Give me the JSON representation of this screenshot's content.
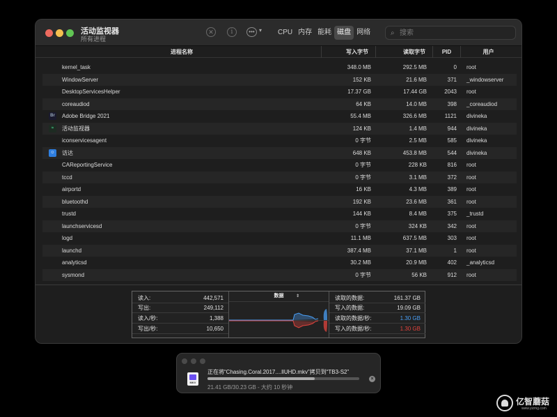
{
  "window": {
    "title": "活动监视器",
    "subtitle": "所有进程"
  },
  "toolbar": {
    "tabs": [
      "CPU",
      "内存",
      "能耗",
      "磁盘",
      "网络"
    ],
    "active_tab": "磁盘",
    "search_placeholder": "搜索"
  },
  "columns": {
    "name": "进程名称",
    "bytes_written": "写入字节",
    "bytes_read": "读取字节",
    "pid": "PID",
    "user": "用户"
  },
  "processes": [
    {
      "name": "kernel_task",
      "written": "348.0 MB",
      "read": "292.5 MB",
      "pid": "0",
      "user": "root",
      "icon": ""
    },
    {
      "name": "WindowServer",
      "written": "152 KB",
      "read": "21.6 MB",
      "pid": "371",
      "user": "_windowserver",
      "icon": ""
    },
    {
      "name": "DesktopServicesHelper",
      "written": "17.37 GB",
      "read": "17.44 GB",
      "pid": "2043",
      "user": "root",
      "icon": ""
    },
    {
      "name": "coreaudiod",
      "written": "64 KB",
      "read": "14.0 MB",
      "pid": "398",
      "user": "_coreaudiod",
      "icon": ""
    },
    {
      "name": "Adobe Bridge 2021",
      "written": "55.4 MB",
      "read": "326.6 MB",
      "pid": "1121",
      "user": "divineka",
      "icon": "bridge-icon"
    },
    {
      "name": "活动监视器",
      "written": "124 KB",
      "read": "1.4 MB",
      "pid": "944",
      "user": "divineka",
      "icon": "activity-monitor-icon"
    },
    {
      "name": "iconservicesagent",
      "written": "0 字节",
      "read": "2.5 MB",
      "pid": "585",
      "user": "divineka",
      "icon": ""
    },
    {
      "name": "访达",
      "written": "648 KB",
      "read": "453.8 MB",
      "pid": "544",
      "user": "divineka",
      "icon": "finder-icon"
    },
    {
      "name": "CAReportingService",
      "written": "0 字节",
      "read": "228 KB",
      "pid": "816",
      "user": "root",
      "icon": ""
    },
    {
      "name": "tccd",
      "written": "0 字节",
      "read": "3.1 MB",
      "pid": "372",
      "user": "root",
      "icon": ""
    },
    {
      "name": "airportd",
      "written": "16 KB",
      "read": "4.3 MB",
      "pid": "389",
      "user": "root",
      "icon": ""
    },
    {
      "name": "bluetoothd",
      "written": "192 KB",
      "read": "23.6 MB",
      "pid": "361",
      "user": "root",
      "icon": ""
    },
    {
      "name": "trustd",
      "written": "144 KB",
      "read": "8.4 MB",
      "pid": "375",
      "user": "_trustd",
      "icon": ""
    },
    {
      "name": "launchservicesd",
      "written": "0 字节",
      "read": "324 KB",
      "pid": "342",
      "user": "root",
      "icon": ""
    },
    {
      "name": "logd",
      "written": "11.1 MB",
      "read": "637.5 MB",
      "pid": "303",
      "user": "root",
      "icon": ""
    },
    {
      "name": "launchd",
      "written": "387.4 MB",
      "read": "37.1 MB",
      "pid": "1",
      "user": "root",
      "icon": ""
    },
    {
      "name": "analyticsd",
      "written": "30.2 MB",
      "read": "20.9 MB",
      "pid": "402",
      "user": "_analyticsd",
      "icon": ""
    },
    {
      "name": "sysmond",
      "written": "0 字节",
      "read": "56 KB",
      "pid": "912",
      "user": "root",
      "icon": ""
    }
  ],
  "stats_left": [
    {
      "label": "读入:",
      "value": "442,571"
    },
    {
      "label": "写出:",
      "value": "249,112"
    },
    {
      "label": "读入/秒:",
      "value": "1,388"
    },
    {
      "label": "写出/秒:",
      "value": "10,650"
    }
  ],
  "graph": {
    "title": "数据",
    "read_color": "#4a9ff5",
    "write_color": "#e0443e"
  },
  "stats_right": [
    {
      "label": "读取的数据:",
      "value": "161.37 GB",
      "color": ""
    },
    {
      "label": "写入的数据:",
      "value": "19.09 GB",
      "color": ""
    },
    {
      "label": "读取的数据/秒:",
      "value": "1.30 GB",
      "color": "blue"
    },
    {
      "label": "写入的数据/秒:",
      "value": "1.30 GB",
      "color": "red"
    }
  ],
  "copy_dialog": {
    "message": "正在将“Chasing.Coral.2017....llUHD.mkv”拷贝到“TB3-S2”",
    "file_ext": "MKV",
    "progress": 0.708,
    "status": "21.41 GB/30.23 GB - 大约 10 秒钟"
  },
  "watermark": {
    "text": "亿智蘑菇",
    "url": "www.yizmg.com"
  }
}
